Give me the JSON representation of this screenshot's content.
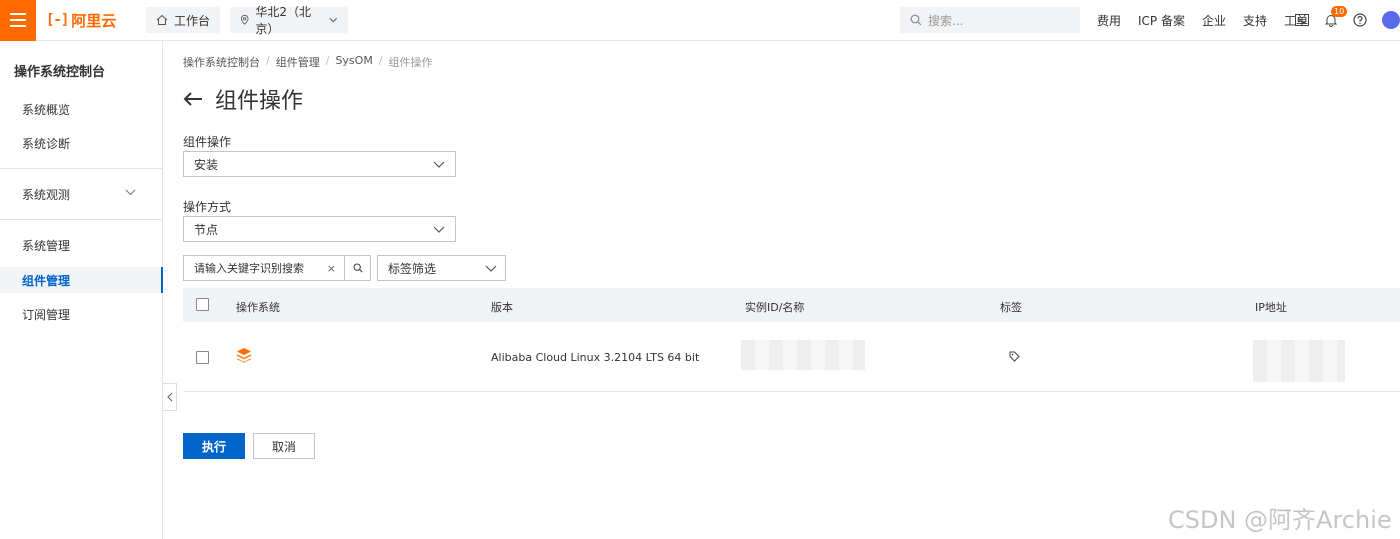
{
  "topbar": {
    "logo_text": "阿里云",
    "workbench": "工作台",
    "region": "华北2（北京）",
    "search_placeholder": "搜索...",
    "links": [
      "费用",
      "ICP 备案",
      "企业",
      "支持",
      "工单"
    ],
    "notification_count": "10",
    "accent_color": "#ff6a00"
  },
  "sidebar": {
    "title": "操作系统控制台",
    "items": [
      "系统概览",
      "系统诊断",
      "系统观测",
      "系统管理",
      "组件管理",
      "订阅管理"
    ],
    "active_item": "组件管理"
  },
  "breadcrumb": [
    "操作系统控制台",
    "组件管理",
    "SysOM",
    "组件操作"
  ],
  "page": {
    "title": "组件操作",
    "operation_label": "组件操作",
    "operation_value": "安装",
    "method_label": "操作方式",
    "method_value": "节点",
    "search_placeholder": "请输入关键字识别搜索",
    "tag_filter": "标签筛选"
  },
  "table": {
    "columns": [
      "操作系统",
      "版本",
      "实例ID/名称",
      "标签",
      "IP地址"
    ],
    "rows": [
      {
        "version": "Alibaba Cloud Linux  3.2104 LTS 64 bit"
      }
    ]
  },
  "actions": {
    "execute": "执行",
    "cancel": "取消",
    "primary_color": "#0064c8"
  },
  "watermark": "CSDN @阿齐Archie"
}
